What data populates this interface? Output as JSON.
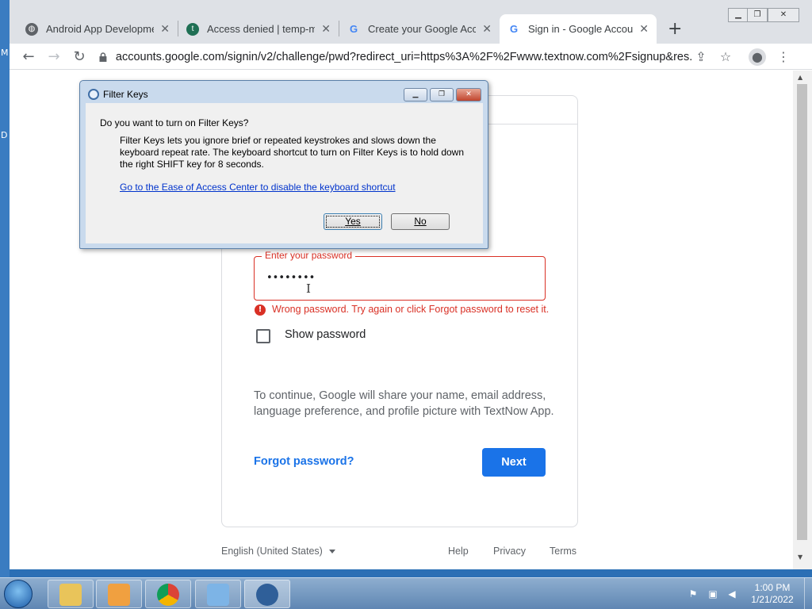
{
  "desktop": {
    "edge_glyphs": [
      "M",
      "D"
    ]
  },
  "browser": {
    "tabs": [
      {
        "label": "Android App Developmen",
        "icon": "globe-icon"
      },
      {
        "label": "Access denied | temp-ma",
        "icon": "temp-mail-icon"
      },
      {
        "label": "Create your Google Acco",
        "icon": "google-g-icon"
      },
      {
        "label": "Sign in - Google Accounts",
        "icon": "google-g-icon",
        "active": true
      }
    ],
    "url": "accounts.google.com/signin/v2/challenge/pwd?redirect_uri=https%3A%2F%2Fwww.textnow.com%2Fsignup&res..."
  },
  "signin": {
    "password_label": "Enter your password",
    "password_value": "••••••••",
    "error_text": "Wrong password. Try again or click Forgot password to reset it.",
    "show_password_label": "Show password",
    "consent_text": "To continue, Google will share your name, email address, language preference, and profile picture with TextNow App.",
    "forgot_label": "Forgot password?",
    "next_label": "Next",
    "accent_color": "#1a73e8",
    "error_color": "#d93025"
  },
  "footer": {
    "language": "English (United States)",
    "help": "Help",
    "privacy": "Privacy",
    "terms": "Terms"
  },
  "dialog": {
    "title": "Filter Keys",
    "question": "Do you want to turn on Filter Keys?",
    "description": "Filter Keys lets you ignore brief or repeated keystrokes and slows down the keyboard repeat rate.  The keyboard shortcut to turn on Filter Keys is to hold down the right SHIFT key for 8 seconds.",
    "link": "Go to the Ease of Access Center to disable the keyboard shortcut",
    "yes_label": "Yes",
    "no_label": "No"
  },
  "taskbar": {
    "time": "1:00 PM",
    "date": "1/21/2022"
  }
}
